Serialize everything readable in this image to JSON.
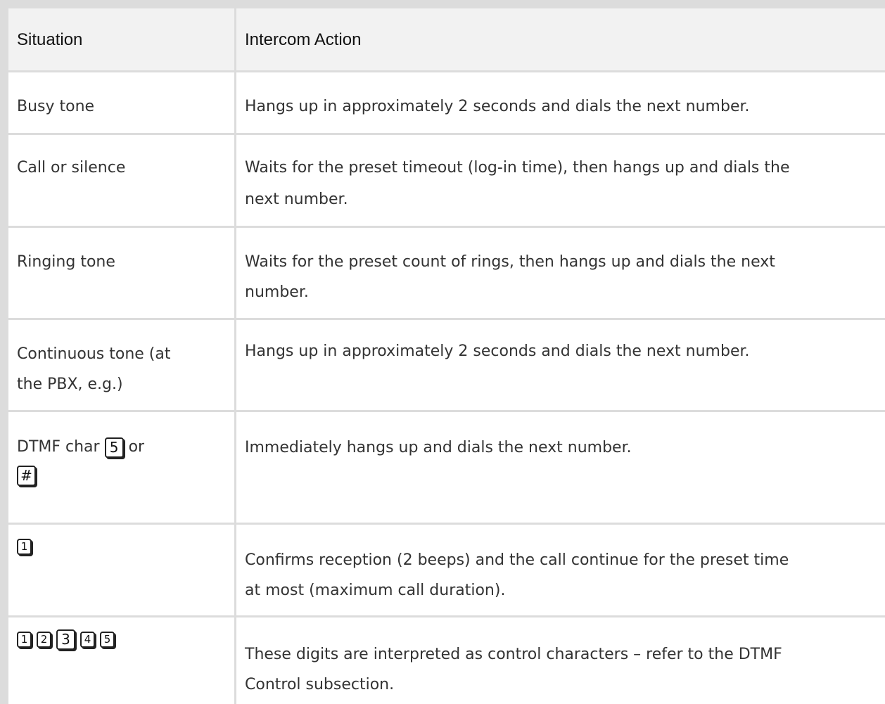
{
  "table": {
    "headers": [
      "Situation",
      "Intercom Action"
    ],
    "rows": [
      {
        "situation": "Busy tone",
        "action": "Hangs up in approximately 2 seconds and dials the next number."
      },
      {
        "situation": "Call or silence",
        "action_line1": "Waits for the preset timeout (log-in time), then hangs up and dials the",
        "action_line2": "next number."
      },
      {
        "situation": "Ringing tone",
        "action_line1": "Waits for the preset count of rings, then hangs up and dials the next",
        "action_line2": "number."
      },
      {
        "situation_line1": "Continuous tone (at",
        "situation_line2": "the PBX, e.g.)",
        "action": "Hangs up in approximately 2 seconds and dials the next number."
      },
      {
        "situation_prefix": "DTMF char",
        "situation_key1": "5",
        "situation_mid": "or",
        "situation_key2": "#",
        "action": "Immediately hangs up and dials the next number."
      },
      {
        "situation_key": "1",
        "action_line1": "Confirms reception (2 beeps) and the call continue for the preset time",
        "action_line2": "at most (maximum call duration)."
      },
      {
        "situation_keys": [
          "1",
          "2",
          "3",
          "4",
          "5"
        ],
        "action_line1": "These digits are interpreted as control characters – refer to the DTMF",
        "action_line2": "Control subsection."
      }
    ]
  }
}
